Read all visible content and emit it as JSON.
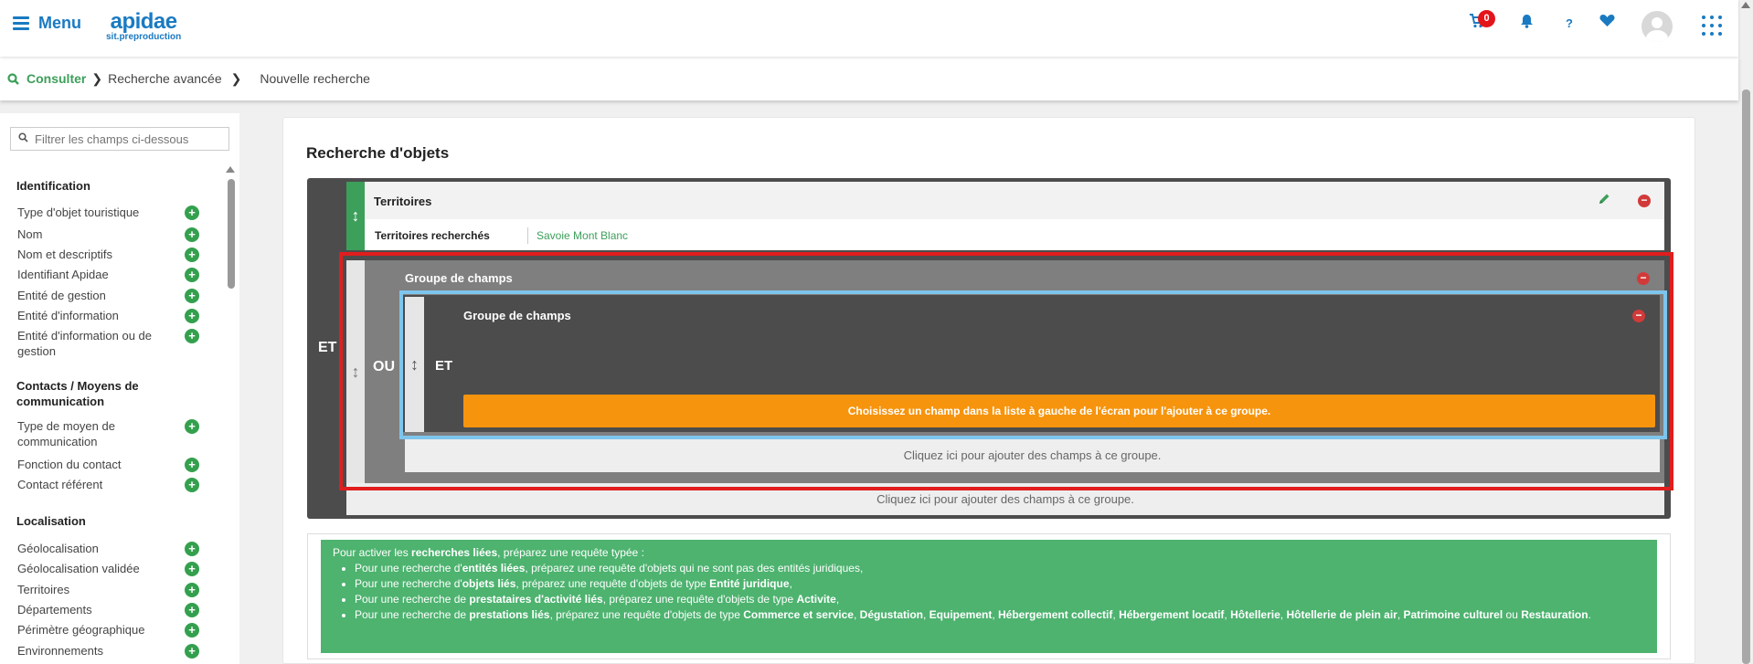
{
  "topbar": {
    "menu_label": "Menu",
    "logo_main": "apidae",
    "logo_sub": "sit.preproduction",
    "cart_count": "0",
    "help_label": "?"
  },
  "breadcrumb": {
    "consult": "Consulter",
    "advanced": "Recherche avancée",
    "current": "Nouvelle recherche"
  },
  "sidebar": {
    "filter_placeholder": "Filtrer les champs ci-dessous",
    "sections": [
      {
        "title": "Identification",
        "items": [
          "Type d'objet touristique",
          "Nom",
          "Nom et descriptifs",
          "Identifiant Apidae",
          "Entité de gestion",
          "Entité d'information",
          "Entité d'information ou de gestion"
        ]
      },
      {
        "title": "Contacts / Moyens de communication",
        "items": [
          "Type de moyen de communication",
          "Fonction du contact",
          "Contact référent"
        ]
      },
      {
        "title": "Localisation",
        "items": [
          "Géolocalisation",
          "Géolocalisation validée",
          "Territoires",
          "Départements",
          "Périmètre géographique",
          "Environnements"
        ]
      }
    ]
  },
  "main": {
    "title": "Recherche d'objets",
    "outer_operator": "ET",
    "territoires": {
      "title": "Territoires",
      "label": "Territoires recherchés",
      "value": "Savoie Mont Blanc"
    },
    "group_ou": {
      "operator": "OU",
      "title": "Groupe de champs"
    },
    "group_et": {
      "operator": "ET",
      "title": "Groupe de champs",
      "choose_text": "Choisissez un champ dans la liste à gauche de l'écran pour l'ajouter à ce groupe."
    },
    "add_fields_text": "Cliquez ici pour ajouter des champs à ce groupe."
  },
  "info": {
    "intro_a": "Pour activer les ",
    "intro_b": "recherches liées",
    "intro_c": ", préparez une requête typée :",
    "l1a": "Pour une recherche d'",
    "l1b": "entités liées",
    "l1c": ", préparez une requête d'objets qui ne sont pas des entités juridiques,",
    "l2a": "Pour une recherche d'",
    "l2b": "objets liés",
    "l2c": ", préparez une requête d'objets de type ",
    "l2d": "Entité juridique",
    "l2e": ",",
    "l3a": "Pour une recherche de ",
    "l3b": "prestataires d'activité liés",
    "l3c": ", préparez une requête d'objets de type ",
    "l3d": "Activite",
    "l3e": ",",
    "l4a": "Pour une recherche de ",
    "l4b": "prestations liés",
    "l4c": ", préparez une requête d'objets de type ",
    "l4d": "Commerce et service",
    "l4e": ", ",
    "l4f": "Dégustation",
    "l4g": ", ",
    "l4h": "Equipement",
    "l4i": ", ",
    "l4j": "Hébergement collectif",
    "l4k": ", ",
    "l4l": "Hébergement locatif",
    "l4m": ", ",
    "l4n": "Hôtellerie",
    "l4o": ", ",
    "l4p": "Hôtellerie de plein air",
    "l4q": ", ",
    "l4r": "Patrimoine culturel",
    "l4s": " ou ",
    "l4t": "Restauration",
    "l4u": "."
  },
  "colors": {
    "accent_blue": "#1a7ac1",
    "green": "#3c9f5a",
    "orange": "#f7940d",
    "highlight_red": "#e11d1d",
    "highlight_blue": "#7ec5ed"
  }
}
